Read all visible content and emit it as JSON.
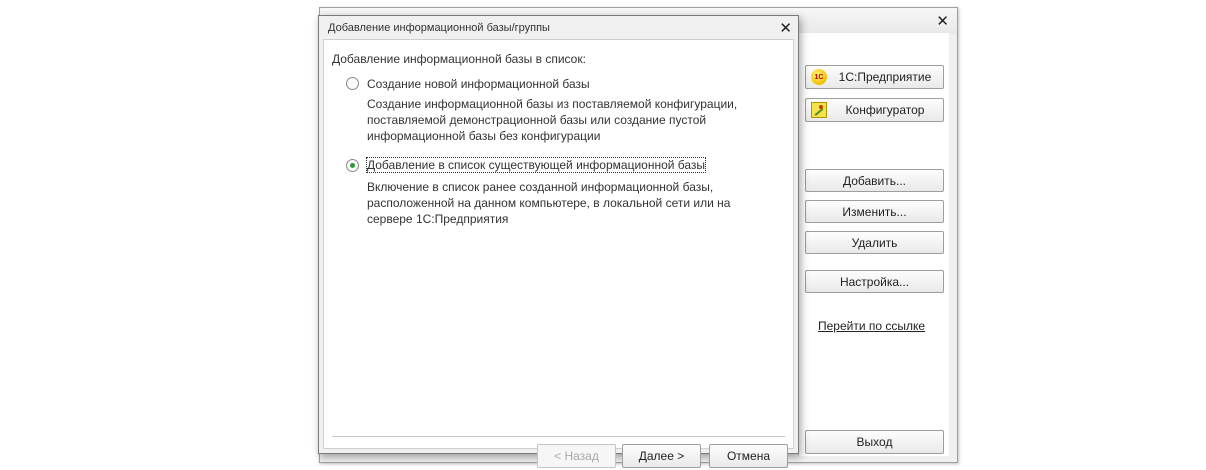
{
  "launcher": {
    "close_glyph": "✕",
    "app_buttons": [
      {
        "label": "1С:Предприятие",
        "icon": "1c-enterprise-icon"
      },
      {
        "label": "Конфигуратор",
        "icon": "configurator-icon"
      }
    ],
    "buttons": {
      "add": "Добавить...",
      "edit": "Изменить...",
      "delete": "Удалить",
      "settings": "Настройка...",
      "exit": "Выход"
    },
    "link": "Перейти по ссылке"
  },
  "dialog": {
    "title": "Добавление информационной базы/группы",
    "close_glyph": "✕",
    "prompt": "Добавление информационной базы в список:",
    "options": [
      {
        "label": "Создание новой информационной базы",
        "description": "Создание информационной базы из поставляемой конфигурации,\nпоставляемой демонстрационной базы или создание пустой\nинформационной базы без конфигурации",
        "selected": false
      },
      {
        "label": "Добавление в список существующей информационной базы",
        "description": "Включение в список ранее созданной информационной базы,\nрасположенной на данном компьютере,  в локальной сети или на\nсервере 1С:Предприятия",
        "selected": true
      }
    ],
    "footer": {
      "back": "< Назад",
      "next": "Далее >",
      "cancel": "Отмена"
    }
  },
  "colors": {
    "radio_selected": "#2c9a3a",
    "icon_1c_red": "#c00000",
    "icon_1c_yellow": "#f2c200"
  }
}
